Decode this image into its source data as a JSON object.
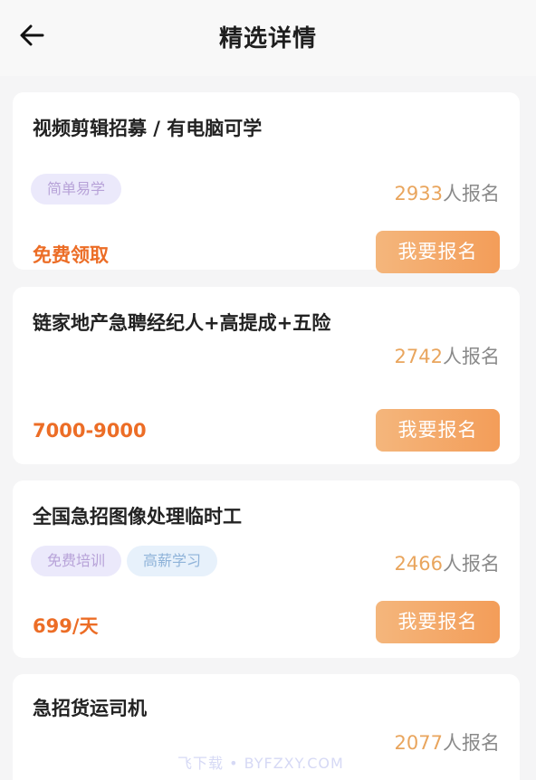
{
  "header": {
    "title": "精选详情",
    "back_icon": "arrow-left-icon"
  },
  "jobs": [
    {
      "title": "视频剪辑招募 /  有电脑可学",
      "tags": [
        "简单易学"
      ],
      "signup_count": "2933",
      "signup_suffix": "人报名",
      "price": "免费领取",
      "button_label": "我要报名"
    },
    {
      "title": "链家地产急聘经纪人+高提成+五险",
      "tags": [],
      "signup_count": "2742",
      "signup_suffix": "人报名",
      "price": "7000-9000",
      "button_label": "我要报名"
    },
    {
      "title": "全国急招图像处理临时工",
      "tags": [
        "免费培训",
        "高薪学习"
      ],
      "signup_count": "2466",
      "signup_suffix": "人报名",
      "price": "699/天",
      "button_label": "我要报名"
    },
    {
      "title": "急招货运司机",
      "tags": [],
      "signup_count": "2077",
      "signup_suffix": "人报名",
      "price": "",
      "button_label": ""
    }
  ],
  "watermark": "飞下载 • BYFZXY.COM",
  "colors": {
    "accent": "#ec6d26",
    "button": "#f39d59",
    "count": "#e9a55d",
    "tag_purple_bg": "#ebe9fb",
    "tag_blue_bg": "#e7f1fb"
  }
}
